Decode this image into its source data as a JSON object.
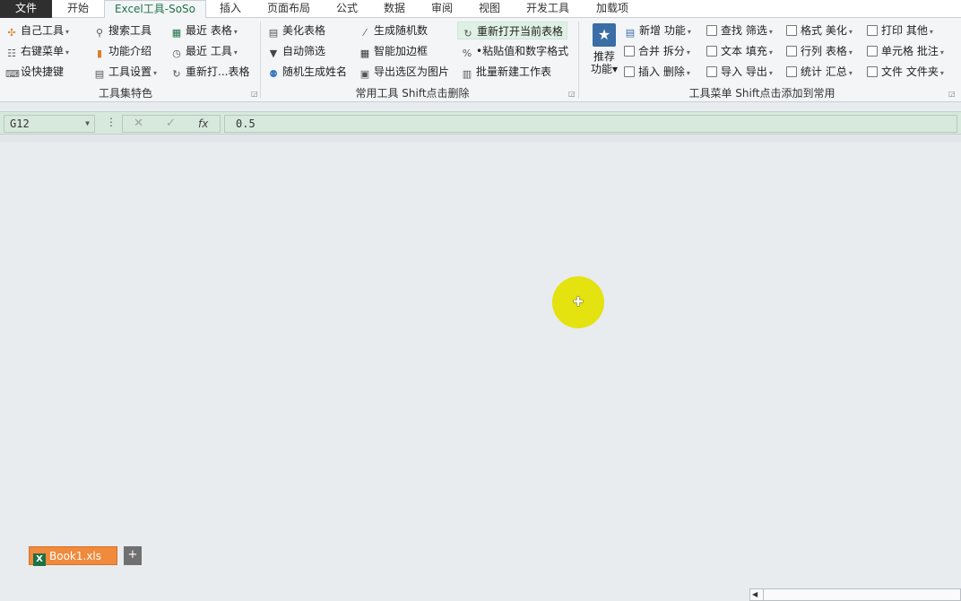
{
  "tabs": [
    "文件",
    "开始",
    "Excel工具-SoSo",
    "插入",
    "页面布局",
    "公式",
    "数据",
    "审阅",
    "视图",
    "开发工具",
    "加载项"
  ],
  "ribbon": {
    "group1": {
      "items": [
        "自己工具",
        "右键菜单",
        "设快捷键",
        "搜索工具",
        "功能介绍",
        "工具设置",
        "最近  表格",
        "最近  工具",
        "重新打...表格"
      ],
      "label": "工具集特色"
    },
    "group2": {
      "items": [
        "美化表格",
        "自动筛选",
        "随机生成姓名",
        "生成随机数",
        "智能加边框",
        "导出选区为图片",
        "重新打开当前表格",
        "•粘贴值和数字格式",
        "批量新建工作表"
      ],
      "label": "常用工具 Shift点击删除"
    },
    "group3": {
      "big_button": [
        "推荐",
        "功能"
      ],
      "items": [
        "新增 功能",
        "合并 拆分",
        "插入 删除",
        "查找 筛选",
        "文本 填充",
        "导入 导出",
        "格式 美化",
        "行列 表格",
        "统计 汇总",
        "打印 其他",
        "单元格 批注",
        "文件 文件夹"
      ],
      "label": "工具菜单 Shift点击添加到常用"
    }
  },
  "formula_bar": {
    "cell_ref": "G12",
    "fx_label": "fx",
    "value": "0.5"
  },
  "sheet_tabs": {
    "book_name": "Book1.xls",
    "add_label": "+"
  },
  "colors": {
    "accent_green": "#217346",
    "formula_bg": "#d7e9dc",
    "book_tab": "#f08a3c",
    "cursor_highlight": "#e4e20f"
  }
}
